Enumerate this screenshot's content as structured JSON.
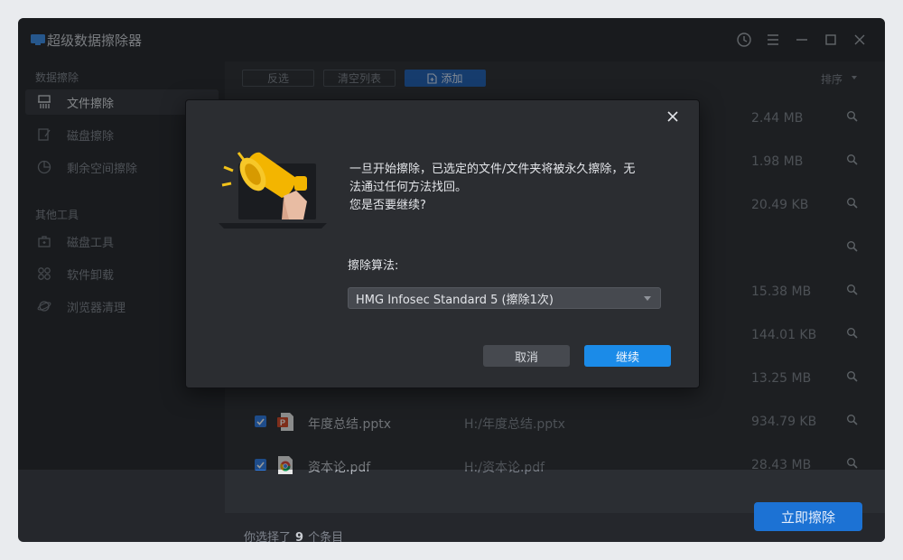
{
  "app": {
    "title": "超级数据擦除器"
  },
  "sidebar": {
    "sections": [
      {
        "title": "数据擦除",
        "items": [
          {
            "label": "文件擦除",
            "icon": "shredder-icon",
            "active": true
          },
          {
            "label": "磁盘擦除",
            "icon": "disk-edit-icon",
            "active": false
          },
          {
            "label": "剩余空间擦除",
            "icon": "pie-chart-icon",
            "active": false
          }
        ]
      },
      {
        "title": "其他工具",
        "items": [
          {
            "label": "磁盘工具",
            "icon": "toolbox-icon",
            "active": false
          },
          {
            "label": "软件卸载",
            "icon": "apps-grid-icon",
            "active": false
          },
          {
            "label": "浏览器清理",
            "icon": "planet-icon",
            "active": false
          }
        ]
      }
    ]
  },
  "toolbar": {
    "invert_label": "反选",
    "clear_label": "清空列表",
    "add_label": "添加",
    "sort_label": "排序"
  },
  "files": [
    {
      "name": "",
      "path": "",
      "size": "2.44 MB",
      "icon": ""
    },
    {
      "name": "",
      "path": "",
      "size": "1.98 MB",
      "icon": ""
    },
    {
      "name": "",
      "path": "",
      "size": "20.49 KB",
      "icon": ""
    },
    {
      "name": "",
      "path": "",
      "size": "",
      "icon": ""
    },
    {
      "name": "",
      "path": "",
      "size": "15.38 MB",
      "icon": ""
    },
    {
      "name": "",
      "path": "",
      "size": "144.01 KB",
      "icon": ""
    },
    {
      "name": "",
      "path": "",
      "size": "13.25 MB",
      "icon": ""
    },
    {
      "name": "年度总结.pptx",
      "path": "H:/年度总结.pptx",
      "size": "934.79 KB",
      "icon": "pptx-file-icon",
      "checked": true
    },
    {
      "name": "资本论.pdf",
      "path": "H:/资本论.pdf",
      "size": "28.43 MB",
      "icon": "chrome-pdf-icon",
      "checked": true
    }
  ],
  "footer": {
    "prefix": "你选择了",
    "count": "9",
    "suffix": "个条目",
    "erase_label": "立即擦除"
  },
  "dialog": {
    "message_line1": "一旦开始擦除，已选定的文件/文件夹将被永久擦除，无",
    "message_line2": "法通过任何方法找回。",
    "message_line3": "您是否要继续?",
    "algorithm_label": "擦除算法:",
    "algorithm_value": "HMG Infosec Standard 5 (擦除1次)",
    "cancel_label": "取消",
    "ok_label": "继续"
  },
  "colors": {
    "accent": "#1c72d4",
    "dialog_ok": "#1b8be8",
    "background": "#25272c",
    "panel": "#2b2e33"
  }
}
